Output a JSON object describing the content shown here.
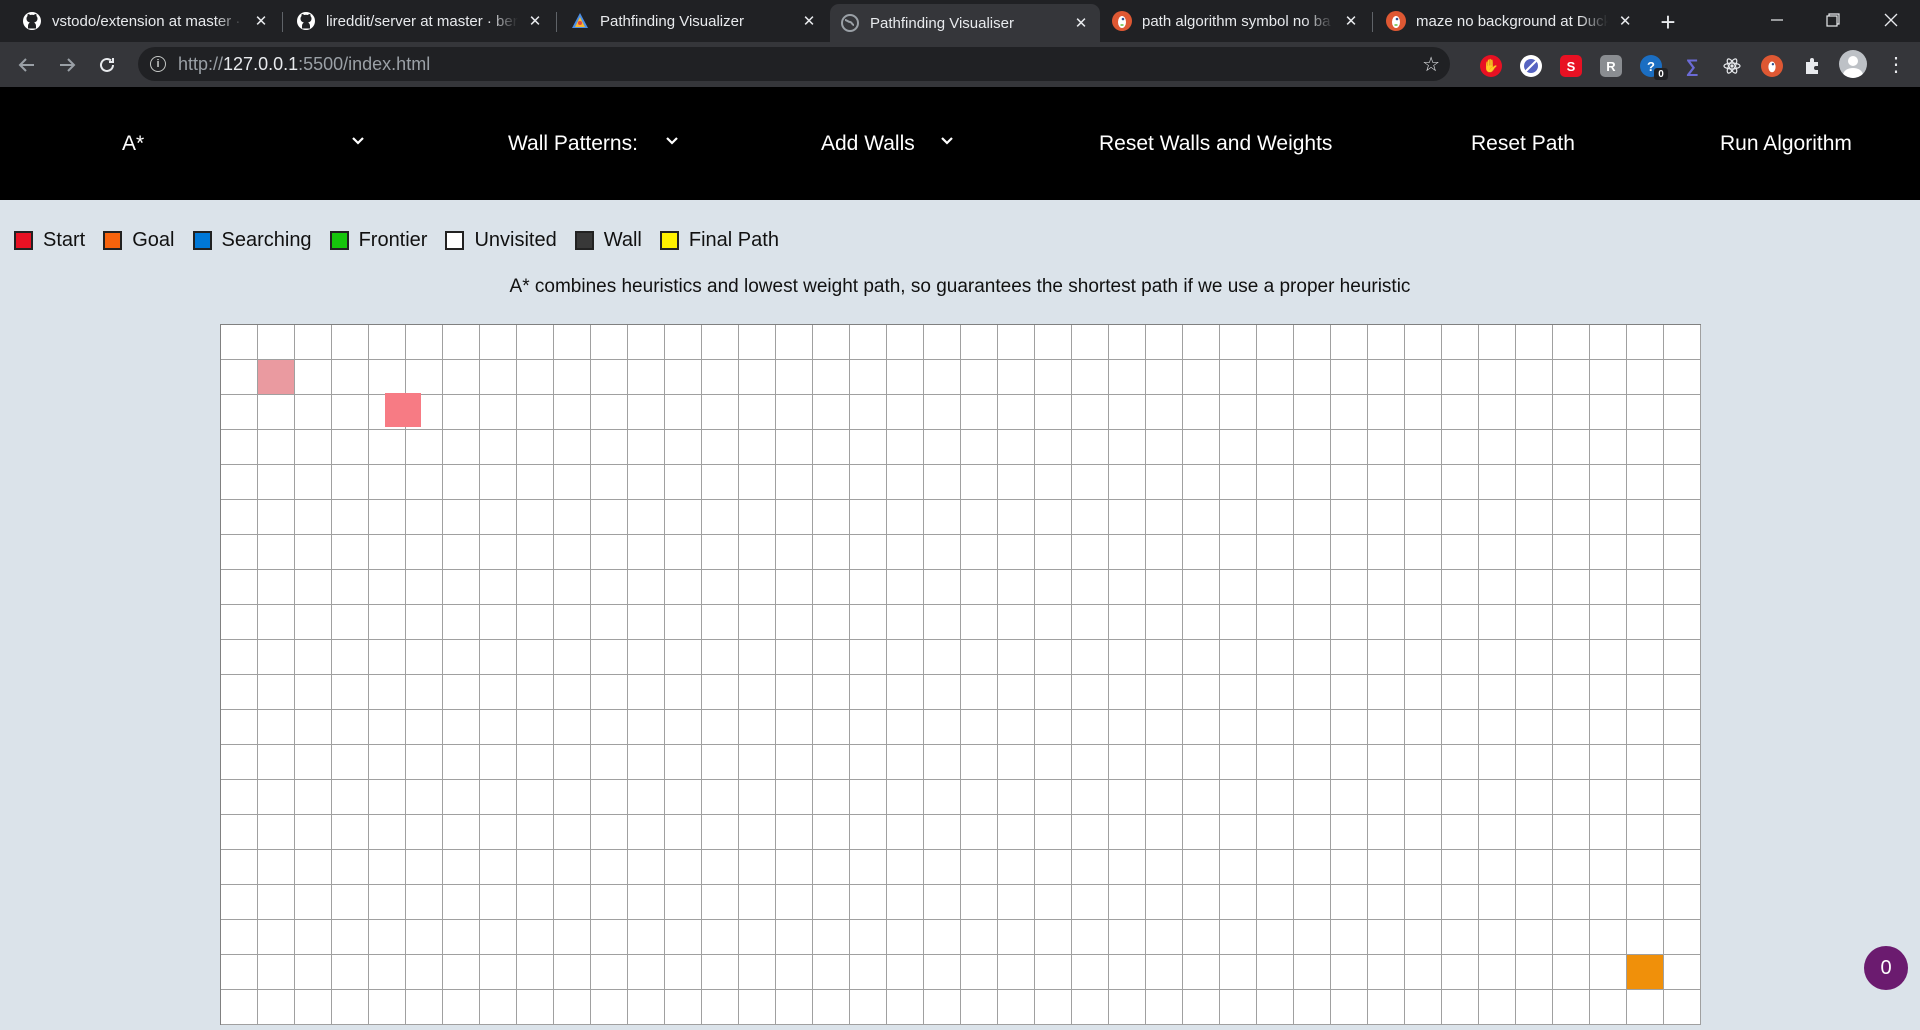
{
  "browser": {
    "tabs": [
      {
        "title": "vstodo/extension at master · ",
        "icon": "github-icon",
        "active": false
      },
      {
        "title": "lireddit/server at master · ber",
        "icon": "github-icon",
        "active": false
      },
      {
        "title": "Pathfinding Visualizer",
        "icon": "pathfinding-icon",
        "active": false
      },
      {
        "title": "Pathfinding Visualiser",
        "icon": "globe-icon",
        "active": true
      },
      {
        "title": "path algorithm symbol no ba",
        "icon": "duckduckgo-icon",
        "active": false
      },
      {
        "title": "maze no background at Duck",
        "icon": "duckduckgo-icon",
        "active": false
      }
    ],
    "url": {
      "scheme": "http://",
      "host": "127.0.0.1",
      "rest": ":5500/index.html"
    },
    "extension_badge": "0"
  },
  "nav": {
    "algorithm": "A*",
    "wall_patterns": "Wall Patterns:",
    "add_walls": "Add Walls",
    "reset_walls": "Reset Walls and Weights",
    "reset_path": "Reset Path",
    "run": "Run Algorithm"
  },
  "legend": [
    {
      "label": "Start",
      "color": "#e81123"
    },
    {
      "label": "Goal",
      "color": "#f7630c"
    },
    {
      "label": "Searching",
      "color": "#0078d7"
    },
    {
      "label": "Frontier",
      "color": "#16c60c"
    },
    {
      "label": "Unvisited",
      "color": "#ffffff"
    },
    {
      "label": "Wall",
      "color": "#383838"
    },
    {
      "label": "Final Path",
      "color": "#fff100"
    }
  ],
  "description": "A* combines heuristics and lowest weight path, so guarantees the shortest path if we use a proper heuristic",
  "grid": {
    "columns": 40,
    "rows": 20,
    "start": {
      "row": 1,
      "col": 1,
      "color": "#ea9aa0"
    },
    "hover_marker": {
      "color": "#f77b84"
    },
    "goal": {
      "row": 18,
      "col": 38,
      "color": "#f0900a"
    }
  },
  "counter": "0"
}
